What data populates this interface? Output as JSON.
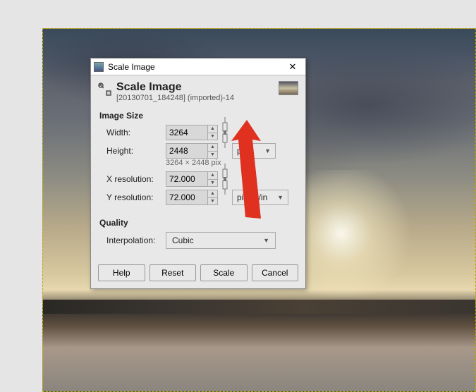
{
  "window": {
    "title": "Scale Image"
  },
  "header": {
    "title": "Scale Image",
    "subtitle": "[20130701_184248] (imported)-14"
  },
  "sections": {
    "image_size": "Image Size",
    "quality": "Quality"
  },
  "labels": {
    "width": "Width:",
    "height": "Height:",
    "xres": "X resolution:",
    "yres": "Y resolution:",
    "interp": "Interpolation:"
  },
  "values": {
    "width": "3264",
    "height": "2448",
    "xres": "72.000",
    "yres": "72.000",
    "dims_text": "3264 × 2448 pix",
    "px_unit": "px",
    "res_unit": "pixels/in",
    "interp": "Cubic"
  },
  "buttons": {
    "help": "Help",
    "reset": "Reset",
    "scale": "Scale",
    "cancel": "Cancel"
  },
  "icons": {
    "chain_linked": "chain-linked-icon"
  }
}
